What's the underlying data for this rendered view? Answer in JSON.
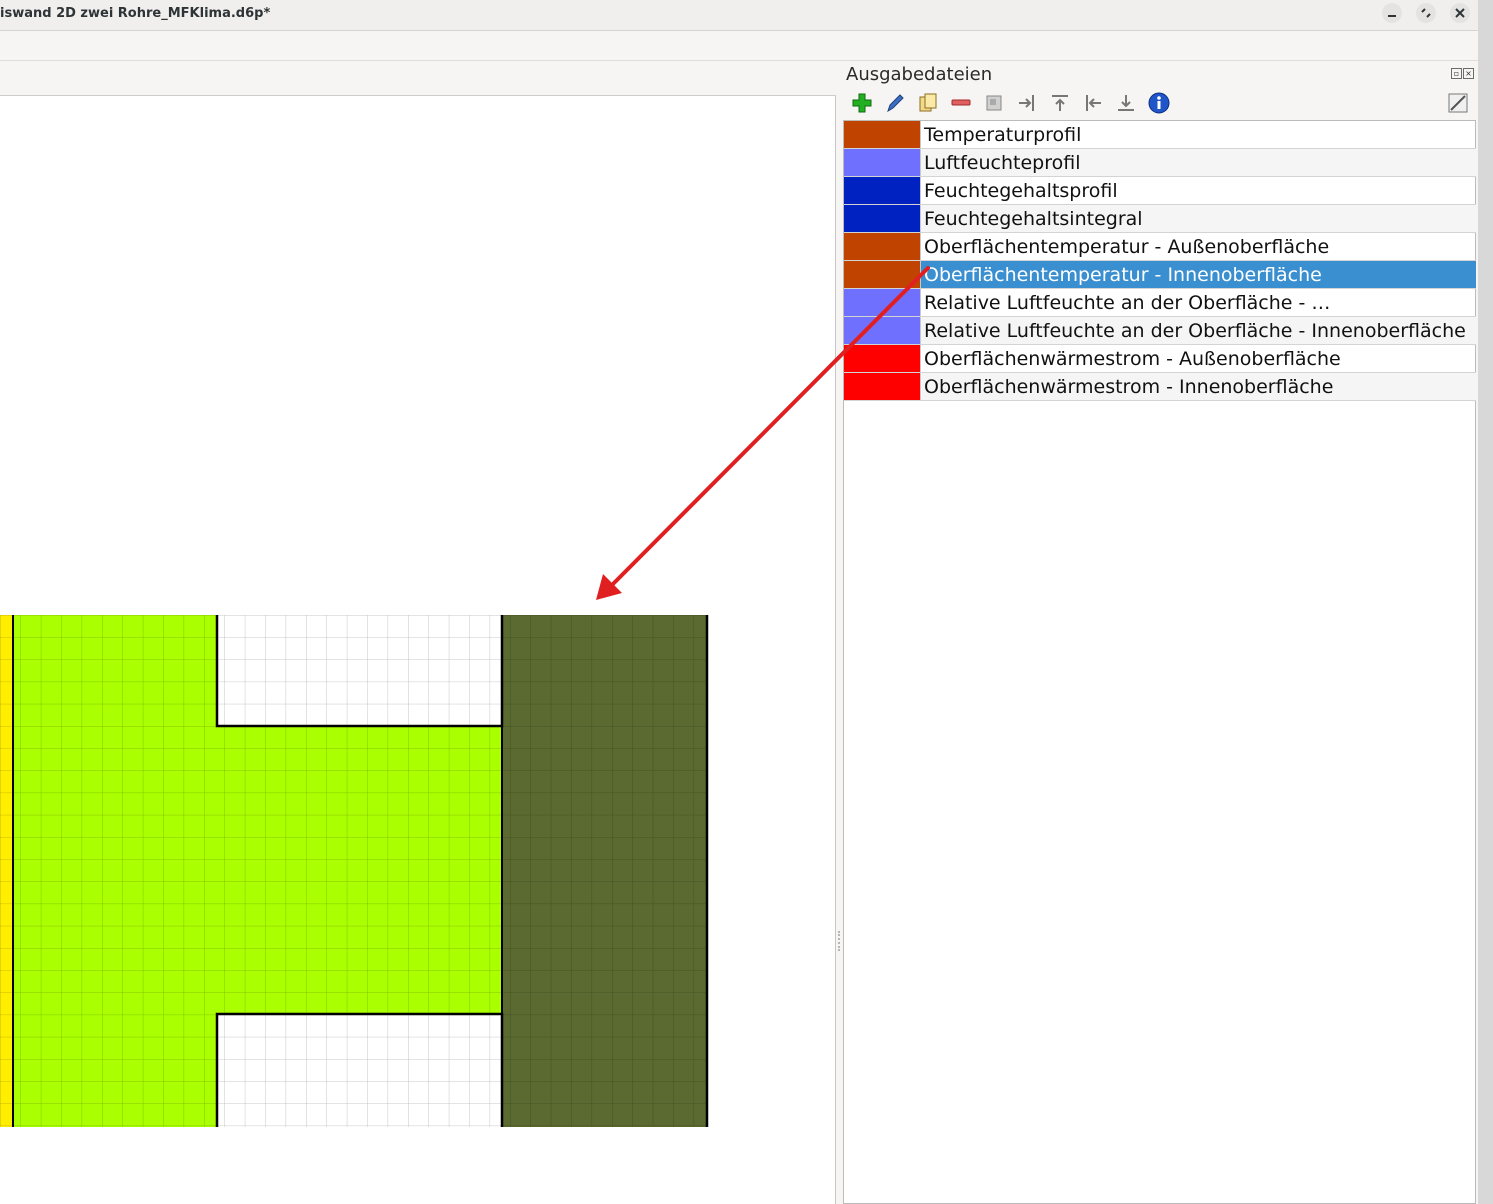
{
  "window": {
    "title": "iswand 2D zwei Rohre_MFKlima.d6p*"
  },
  "dock": {
    "title": "Ausgabedateien",
    "toolbar": [
      {
        "icon": "add-icon"
      },
      {
        "icon": "edit-pencil-icon"
      },
      {
        "icon": "copy-icon"
      },
      {
        "icon": "remove-icon"
      },
      {
        "icon": "align-icon"
      },
      {
        "icon": "move-right-icon"
      },
      {
        "icon": "move-top-icon"
      },
      {
        "icon": "move-left-icon"
      },
      {
        "icon": "move-bottom-icon"
      },
      {
        "icon": "info-icon"
      },
      {
        "icon": "toggle-view-icon"
      }
    ],
    "selected_index": 5,
    "rows": [
      {
        "label": "Temperaturprofil",
        "color": "#c04400"
      },
      {
        "label": "Luftfeuchteprofil",
        "color": "#7070ff"
      },
      {
        "label": "Feuchtegehaltsprofil",
        "color": "#0022c0"
      },
      {
        "label": "Feuchtegehaltsintegral",
        "color": "#0022c0"
      },
      {
        "label": "Oberflächentemperatur - Außenoberfläche",
        "color": "#c04400"
      },
      {
        "label": "Oberflächentemperatur - Innenoberfläche",
        "color": "#c04400"
      },
      {
        "label": "Relative Luftfeuchte an der Oberfläche - …",
        "color": "#7070ff"
      },
      {
        "label": "Relative Luftfeuchte an der Oberfläche - Innenoberfläche",
        "color": "#7070ff"
      },
      {
        "label": "Oberflächenwärmestrom - Außenoberfläche",
        "color": "#ff0000"
      },
      {
        "label": "Oberflächenwärmestrom - Innenoberfläche",
        "color": "#ff0000"
      }
    ]
  },
  "geometry_colors": {
    "yellow": "#ffee00",
    "light_green": "#aaff00",
    "dark_green": "#5a6a30",
    "annotation_arrow": "#e02020"
  }
}
